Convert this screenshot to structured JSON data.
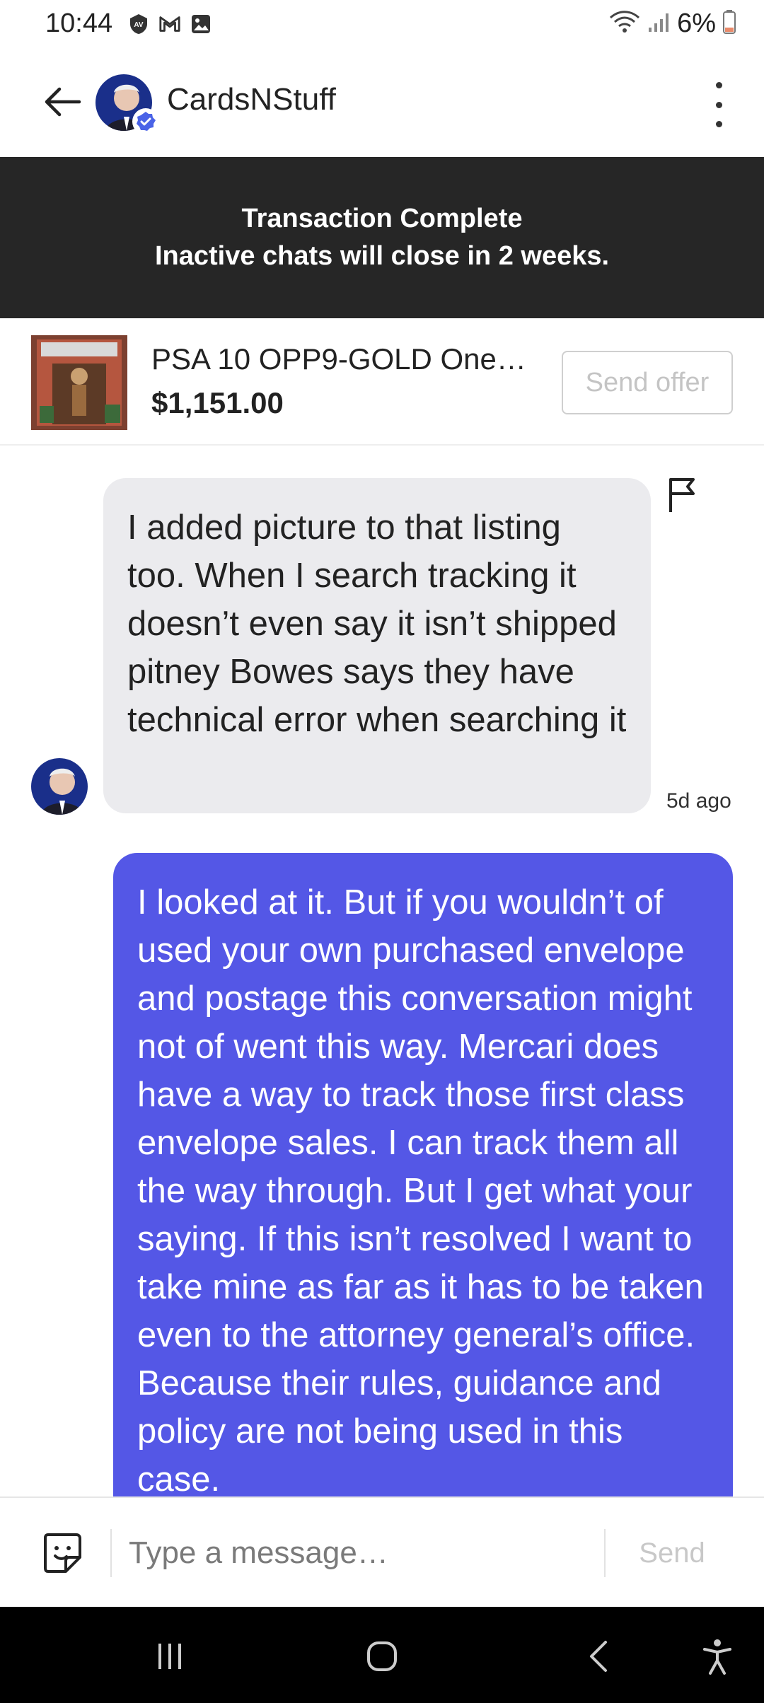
{
  "status_bar": {
    "time": "10:44",
    "battery": "6%",
    "left_icons": [
      "av-icon",
      "gmail-icon",
      "gallery-icon"
    ],
    "right_icons": [
      "wifi-icon",
      "signal-icon",
      "battery-low-icon"
    ]
  },
  "header": {
    "username": "CardsNStuff",
    "verified": true
  },
  "banner": {
    "title": "Transaction Complete",
    "subtitle": "Inactive chats will close in 2 weeks."
  },
  "product": {
    "title": "PSA 10 OPP9-GOLD One…",
    "price": "$1,151.00",
    "offer_button": "Send offer"
  },
  "messages": [
    {
      "direction": "incoming",
      "text": "I added picture to that listing too. When I search tracking it doesn’t even say it isn’t shipped pitney Bowes says they have technical error when searching it",
      "time": "5d ago"
    },
    {
      "direction": "outgoing",
      "text": "I looked at it. But if you wouldn’t of used your own purchased envelope and postage this conversation might not of went this way. Mercari does have a way to track those first class envelope sales. I can track them all the way through. But I get what your saying. If this isn’t resolved I want to take mine as far as it has to be taken even to the attorney general’s office. Because their rules, guidance and policy are not being used in this case."
    }
  ],
  "composer": {
    "placeholder": "Type a message…",
    "send_label": "Send"
  },
  "colors": {
    "outgoing_bubble": "#5457e6",
    "incoming_bubble": "#ebebee",
    "banner_bg": "#262626",
    "verified_badge": "#4a63e7"
  }
}
